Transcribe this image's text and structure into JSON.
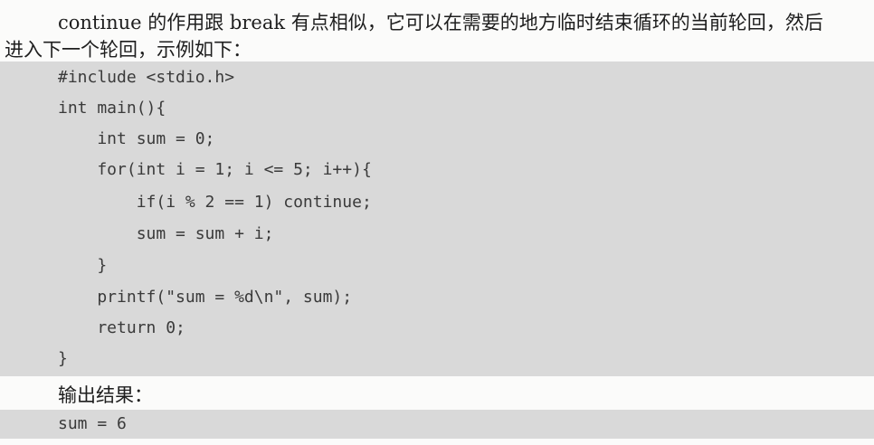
{
  "intro": {
    "line1": "continue 的作用跟 break 有点相似，它可以在需要的地方临时结束循环的当前轮回，然后",
    "line2": "进入下一个轮回，示例如下："
  },
  "code": {
    "lines": [
      "#include <stdio.h>",
      "int main(){",
      "    int sum = 0;",
      "    for(int i = 1; i <= 5; i++){",
      "        if(i % 2 == 1) continue;",
      "        sum = sum + i;",
      "    }",
      "    printf(\"sum = %d\\n\", sum);",
      "    return 0;",
      "}"
    ]
  },
  "output": {
    "label": "输出结果：",
    "text": "sum = 6"
  }
}
